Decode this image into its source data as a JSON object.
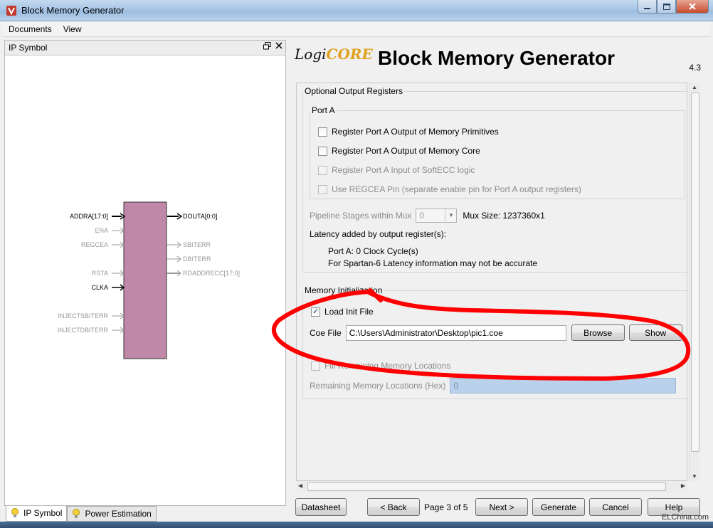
{
  "window": {
    "title": "Block Memory Generator"
  },
  "menu": {
    "items": [
      "Documents",
      "View"
    ]
  },
  "left_panel": {
    "header": "IP Symbol",
    "symbol": {
      "inputs": [
        "ADDRA[17:0]",
        "ENA",
        "REGCEA",
        "RSTA",
        "CLKA",
        "INJECTSBITERR",
        "INJECTDBITERR"
      ],
      "outputs": [
        "DOUTA[0:0]",
        "SBITERR",
        "DBITERR",
        "RDADDRECC[17:0]"
      ],
      "block_color": "#c088a8"
    },
    "tabs": [
      "IP Symbol",
      "Power Estimation"
    ]
  },
  "right_panel": {
    "logo_a": "Logi",
    "logo_b": "CORE",
    "title": "Block Memory Generator",
    "version": "4.3",
    "optional_output_registers": {
      "legend": "Optional Output Registers",
      "port_a_legend": "Port A",
      "opt1": "Register Port A Output of Memory Primitives",
      "opt2": "Register Port A Output of Memory Core",
      "opt3": "Register Port A Input of SoftECC logic",
      "opt4": "Use REGCEA Pin (separate enable pin for Port A output registers)",
      "pipeline_label": "Pipeline Stages within Mux",
      "pipeline_value": "0",
      "mux_size": "Mux Size: 1237360x1",
      "latency_label": "Latency added by output register(s):",
      "latency_port_a": "Port A: 0 Clock Cycle(s)",
      "latency_note": "For Spartan-6 Latency information may not be accurate"
    },
    "memory_init": {
      "legend": "Memory Initialization",
      "load_init_label": "Load Init File",
      "load_init_checked": true,
      "coe_label": "Coe File",
      "coe_value": "C:\\Users\\Administrator\\Desktop\\pic1.coe",
      "browse": "Browse",
      "show": "Show",
      "fill_label": "Fill Remaining Memory Locations",
      "remaining_label": "Remaining Memory Locations (Hex)",
      "remaining_value": "0"
    },
    "annotation_color": "#ff0000"
  },
  "buttons": {
    "datasheet": "Datasheet",
    "back": "< Back",
    "page": "Page 3 of 5",
    "next": "Next >",
    "generate": "Generate",
    "cancel": "Cancel",
    "help": "Help"
  },
  "watermark": "ELChina.com"
}
